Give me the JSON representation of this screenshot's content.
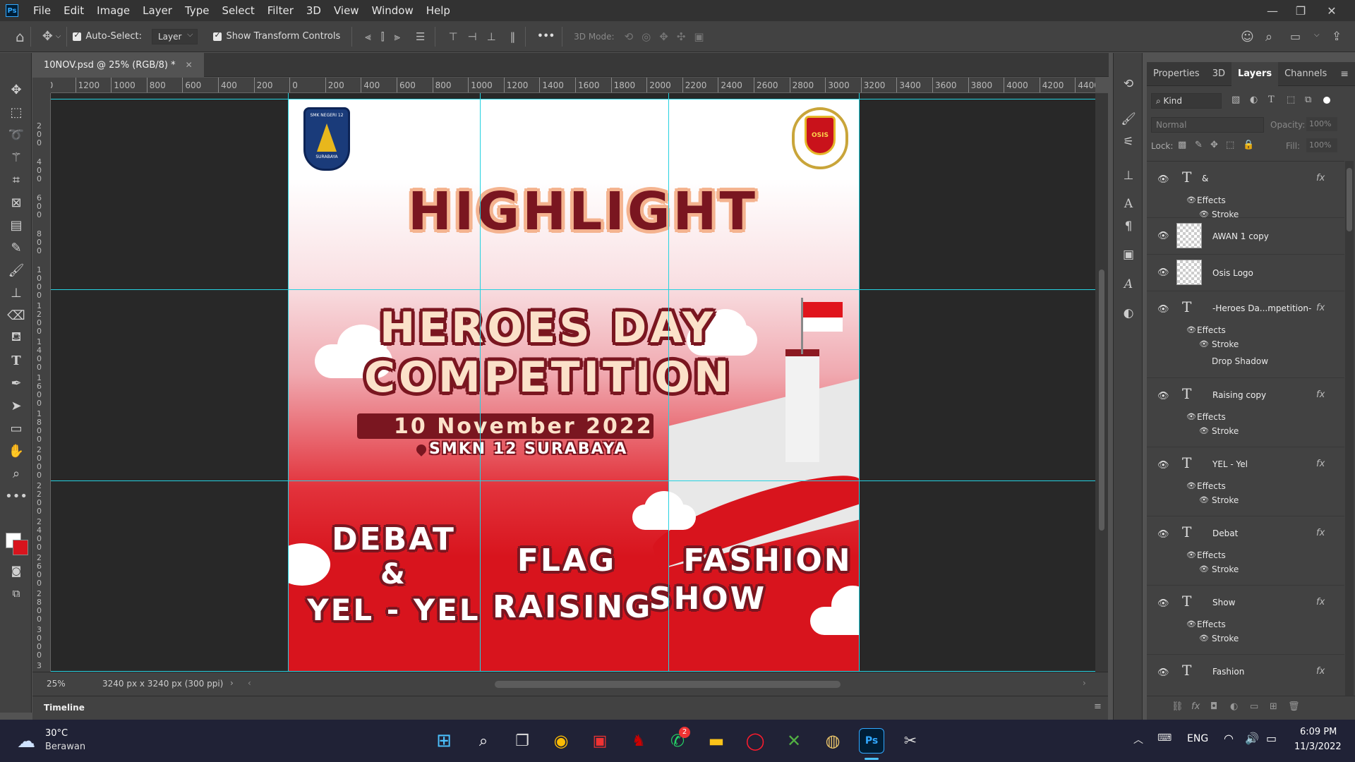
{
  "app": {
    "logo": "Ps",
    "menu": [
      "File",
      "Edit",
      "Image",
      "Layer",
      "Type",
      "Select",
      "Filter",
      "3D",
      "View",
      "Window",
      "Help"
    ]
  },
  "options": {
    "auto_select_label": "Auto-Select:",
    "auto_select_value": "Layer",
    "transform_label": "Show Transform Controls",
    "mode_3d_label": "3D Mode:",
    "more_label": "•••"
  },
  "document": {
    "tab_title": "10NOV.psd @ 25% (RGB/8) *",
    "zoom": "25%",
    "dimensions": "3240 px x 3240 px (300 ppi)",
    "ruler_top": [
      "00",
      "1200",
      "1000",
      "800",
      "600",
      "400",
      "200",
      "0",
      "200",
      "400",
      "600",
      "800",
      "1000",
      "1200",
      "1400",
      "1600",
      "1800",
      "2000",
      "2200",
      "2400",
      "2600",
      "2800",
      "3000",
      "3200",
      "3400",
      "3600",
      "3800",
      "4000",
      "4200",
      "4400"
    ],
    "ruler_left": [
      "0",
      "2\n0\n0",
      "4\n0\n0",
      "6\n0\n0",
      "8\n0\n0",
      "1\n0\n0\n0",
      "1\n2\n0\n0",
      "1\n4\n0\n0",
      "1\n6\n0\n0",
      "1\n8\n0\n0",
      "2\n0\n0\n0",
      "2\n2\n0\n0",
      "2\n4\n0\n0",
      "2\n6\n0\n0",
      "2\n8\n0\n0",
      "3\n0\n0\n0",
      "3"
    ]
  },
  "artwork": {
    "logo_left_text": "SMK NEGERI 12",
    "logo_left_sub": "SURABAYA",
    "logo_right_text": "OSIS",
    "title": "HIGHLIGHT",
    "heroes_line1": "HEROES DAY",
    "heroes_line2": "COMPETITION",
    "date": "10 November 2022",
    "location": "SMKN 12 SURABAYA",
    "event1_line1": "DEBAT",
    "event1_line2": "&",
    "event1_line3": "YEL - YEL",
    "event2_line1": "FLAG",
    "event2_line2": "RAISING",
    "event3_line1": "FASHION",
    "event3_line2": "SHOW",
    "colors": {
      "dark_red": "#7a1620",
      "red": "#d8141d",
      "peach": "#f4b38f",
      "cream": "#fbe1c9"
    }
  },
  "timeline_label": "Timeline",
  "panels": {
    "tabs": [
      "Properties",
      "3D",
      "Layers",
      "Channels"
    ],
    "filter_kind": "Kind",
    "blend_mode": "Normal",
    "opacity_label": "Opacity:",
    "opacity_value": "100%",
    "lock_label": "Lock:",
    "fill_label": "Fill:",
    "fill_value": "100%",
    "layers": [
      {
        "name": "&",
        "type": "text",
        "fx": "fx",
        "effects": "Effects",
        "sub": [
          "Stroke"
        ]
      },
      {
        "name": "AWAN 1 copy",
        "type": "smart"
      },
      {
        "name": "Osis Logo",
        "type": "pixel"
      },
      {
        "name": "-Heroes Da...mpetition-",
        "type": "text",
        "fx": "fx",
        "effects": "Effects",
        "sub": [
          "Stroke",
          "Drop Shadow"
        ]
      },
      {
        "name": "Raising copy",
        "type": "text",
        "fx": "fx",
        "effects": "Effects",
        "sub": [
          "Stroke"
        ]
      },
      {
        "name": "YEL - Yel",
        "type": "text",
        "fx": "fx",
        "effects": "Effects",
        "sub": [
          "Stroke"
        ]
      },
      {
        "name": "Debat",
        "type": "text",
        "fx": "fx",
        "effects": "Effects",
        "sub": [
          "Stroke"
        ]
      },
      {
        "name": "Show",
        "type": "text",
        "fx": "fx",
        "effects": "Effects",
        "sub": [
          "Stroke"
        ]
      },
      {
        "name": "Fashion",
        "type": "text",
        "fx": "fx"
      }
    ]
  },
  "taskbar": {
    "weather_temp": "30°C",
    "weather_desc": "Berawan",
    "lang": "ENG",
    "time": "6:09 PM",
    "date": "11/3/2022",
    "whatsapp_badge": "2"
  }
}
